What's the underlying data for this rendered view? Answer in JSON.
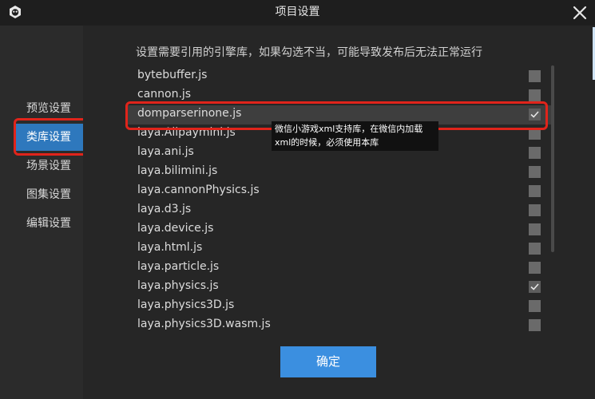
{
  "window": {
    "title": "项目设置"
  },
  "sidebar": {
    "items": [
      {
        "label": "预览设置"
      },
      {
        "label": "类库设置",
        "active": true
      },
      {
        "label": "场景设置"
      },
      {
        "label": "图集设置"
      },
      {
        "label": "编辑设置"
      }
    ]
  },
  "main": {
    "description": "设置需要引用的引擎库，如果勾选不当，可能导致发布后无法正常运行",
    "libraries": [
      {
        "name": "bytebuffer.js",
        "checked": false
      },
      {
        "name": "cannon.js",
        "checked": false
      },
      {
        "name": "domparserinone.js",
        "checked": true,
        "highlighted": true
      },
      {
        "name": "laya.Alipaymini.js",
        "checked": false
      },
      {
        "name": "laya.ani.js",
        "checked": false
      },
      {
        "name": "laya.bilimini.js",
        "checked": false
      },
      {
        "name": "laya.cannonPhysics.js",
        "checked": false
      },
      {
        "name": "laya.d3.js",
        "checked": false
      },
      {
        "name": "laya.device.js",
        "checked": false
      },
      {
        "name": "laya.html.js",
        "checked": false
      },
      {
        "name": "laya.particle.js",
        "checked": false
      },
      {
        "name": "laya.physics.js",
        "checked": true
      },
      {
        "name": "laya.physics3D.js",
        "checked": false
      },
      {
        "name": "laya.physics3D.wasm.js",
        "checked": false
      }
    ],
    "tooltip": {
      "line1": "微信小游戏xml支持库，在微信内加载",
      "line2": "xml的时候，必须使用本库"
    },
    "confirm_label": "确定"
  },
  "colors": {
    "accent": "#3b8fe0",
    "nav_active": "#2e78bd",
    "annotation_red": "#e0241b"
  },
  "icons": {
    "app": "laya-app-icon",
    "close": "close-icon",
    "check": "checkmark-icon"
  }
}
